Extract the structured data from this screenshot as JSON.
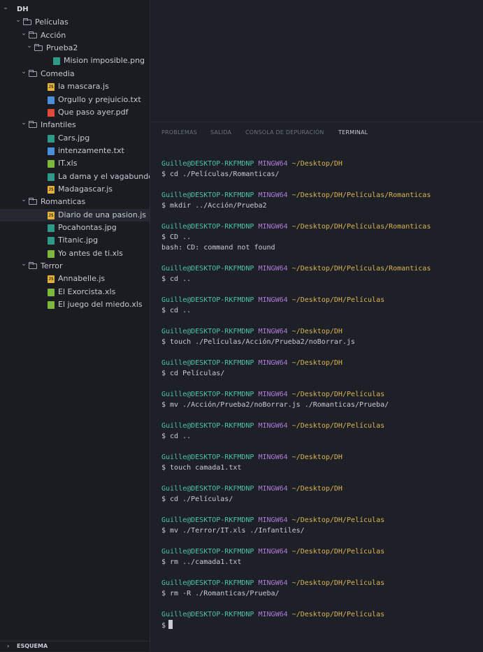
{
  "sidebar": {
    "root": "DH",
    "outline_label": "ESQUEMA",
    "items": [
      {
        "type": "folder",
        "label": "Películas"
      },
      {
        "type": "folder",
        "label": "Acción"
      },
      {
        "type": "folder",
        "label": "Prueba2"
      },
      {
        "type": "file",
        "label": "Mision imposible.png",
        "kind": "img",
        "icon": "image-file-icon"
      },
      {
        "type": "folder",
        "label": "Comedia"
      },
      {
        "type": "file",
        "label": "la mascara.js",
        "kind": "js",
        "icon": "js-file-icon"
      },
      {
        "type": "file",
        "label": "Orgullo y prejuicio.txt",
        "kind": "txt",
        "icon": "text-file-icon"
      },
      {
        "type": "file",
        "label": "Que paso ayer.pdf",
        "kind": "pdf",
        "icon": "pdf-file-icon"
      },
      {
        "type": "folder",
        "label": "Infantiles"
      },
      {
        "type": "file",
        "label": "Cars.jpg",
        "kind": "img",
        "icon": "image-file-icon"
      },
      {
        "type": "file",
        "label": "intenzamente.txt",
        "kind": "txt",
        "icon": "text-file-icon"
      },
      {
        "type": "file",
        "label": "IT.xls",
        "kind": "xls",
        "icon": "spreadsheet-file-icon"
      },
      {
        "type": "file",
        "label": "La dama y el vagabundo.png",
        "kind": "img",
        "icon": "image-file-icon"
      },
      {
        "type": "file",
        "label": "Madagascar.js",
        "kind": "js",
        "icon": "js-file-icon"
      },
      {
        "type": "folder",
        "label": "Romanticas"
      },
      {
        "type": "file",
        "label": "Diario de una pasion.js",
        "kind": "js",
        "icon": "js-file-icon",
        "selected": true
      },
      {
        "type": "file",
        "label": "Pocahontas.jpg",
        "kind": "img",
        "icon": "image-file-icon"
      },
      {
        "type": "file",
        "label": "Titanic.jpg",
        "kind": "img",
        "icon": "image-file-icon"
      },
      {
        "type": "file",
        "label": "Yo antes de ti.xls",
        "kind": "xls",
        "icon": "spreadsheet-file-icon"
      },
      {
        "type": "folder",
        "label": "Terror"
      },
      {
        "type": "file",
        "label": "Annabelle.js",
        "kind": "js",
        "icon": "js-file-icon"
      },
      {
        "type": "file",
        "label": "El Exorcista.xls",
        "kind": "xls",
        "icon": "spreadsheet-file-icon"
      },
      {
        "type": "file",
        "label": "El juego del miedo.xls",
        "kind": "xls",
        "icon": "spreadsheet-file-icon"
      }
    ]
  },
  "panel": {
    "tabs": [
      {
        "label": "PROBLEMAS"
      },
      {
        "label": "SALIDA"
      },
      {
        "label": "CONSOLA DE DEPURACIÓN"
      },
      {
        "label": "TERMINAL",
        "active": true
      }
    ]
  },
  "terminal": {
    "user": "Guille@DESKTOP-RKFMDNP",
    "system": "MINGW64",
    "entries": [
      {
        "path": "~/Desktop/DH",
        "command": "$ cd ./Películas/Romanticas/"
      },
      {
        "path": "~/Desktop/DH/Películas/Romanticas",
        "command": "$ mkdir ../Acción/Prueba2"
      },
      {
        "path": "~/Desktop/DH/Películas/Romanticas",
        "command": "$ CD ..",
        "output": "bash: CD: command not found"
      },
      {
        "path": "~/Desktop/DH/Películas/Romanticas",
        "command": "$ cd .."
      },
      {
        "path": "~/Desktop/DH/Películas",
        "command": "$ cd .."
      },
      {
        "path": "~/Desktop/DH",
        "command": "$ touch ./Películas/Acción/Prueba2/noBorrar.js"
      },
      {
        "path": "~/Desktop/DH",
        "command": "$ cd Películas/"
      },
      {
        "path": "~/Desktop/DH/Películas",
        "command": "$ mv ./Acción/Prueba2/noBorrar.js ./Romanticas/Prueba/"
      },
      {
        "path": "~/Desktop/DH/Películas",
        "command": "$ cd .."
      },
      {
        "path": "~/Desktop/DH",
        "command": "$ touch camada1.txt"
      },
      {
        "path": "~/Desktop/DH",
        "command": "$ cd ./Películas/"
      },
      {
        "path": "~/Desktop/DH/Películas",
        "command": "$ mv ./Terror/IT.xls ./Infantiles/"
      },
      {
        "path": "~/Desktop/DH/Películas",
        "command": "$ rm ../camada1.txt"
      },
      {
        "path": "~/Desktop/DH/Películas",
        "command": "$ rm -R ./Romanticas/Prueba/"
      },
      {
        "path": "~/Desktop/DH/Películas",
        "command": "$",
        "cursor": true
      }
    ]
  }
}
